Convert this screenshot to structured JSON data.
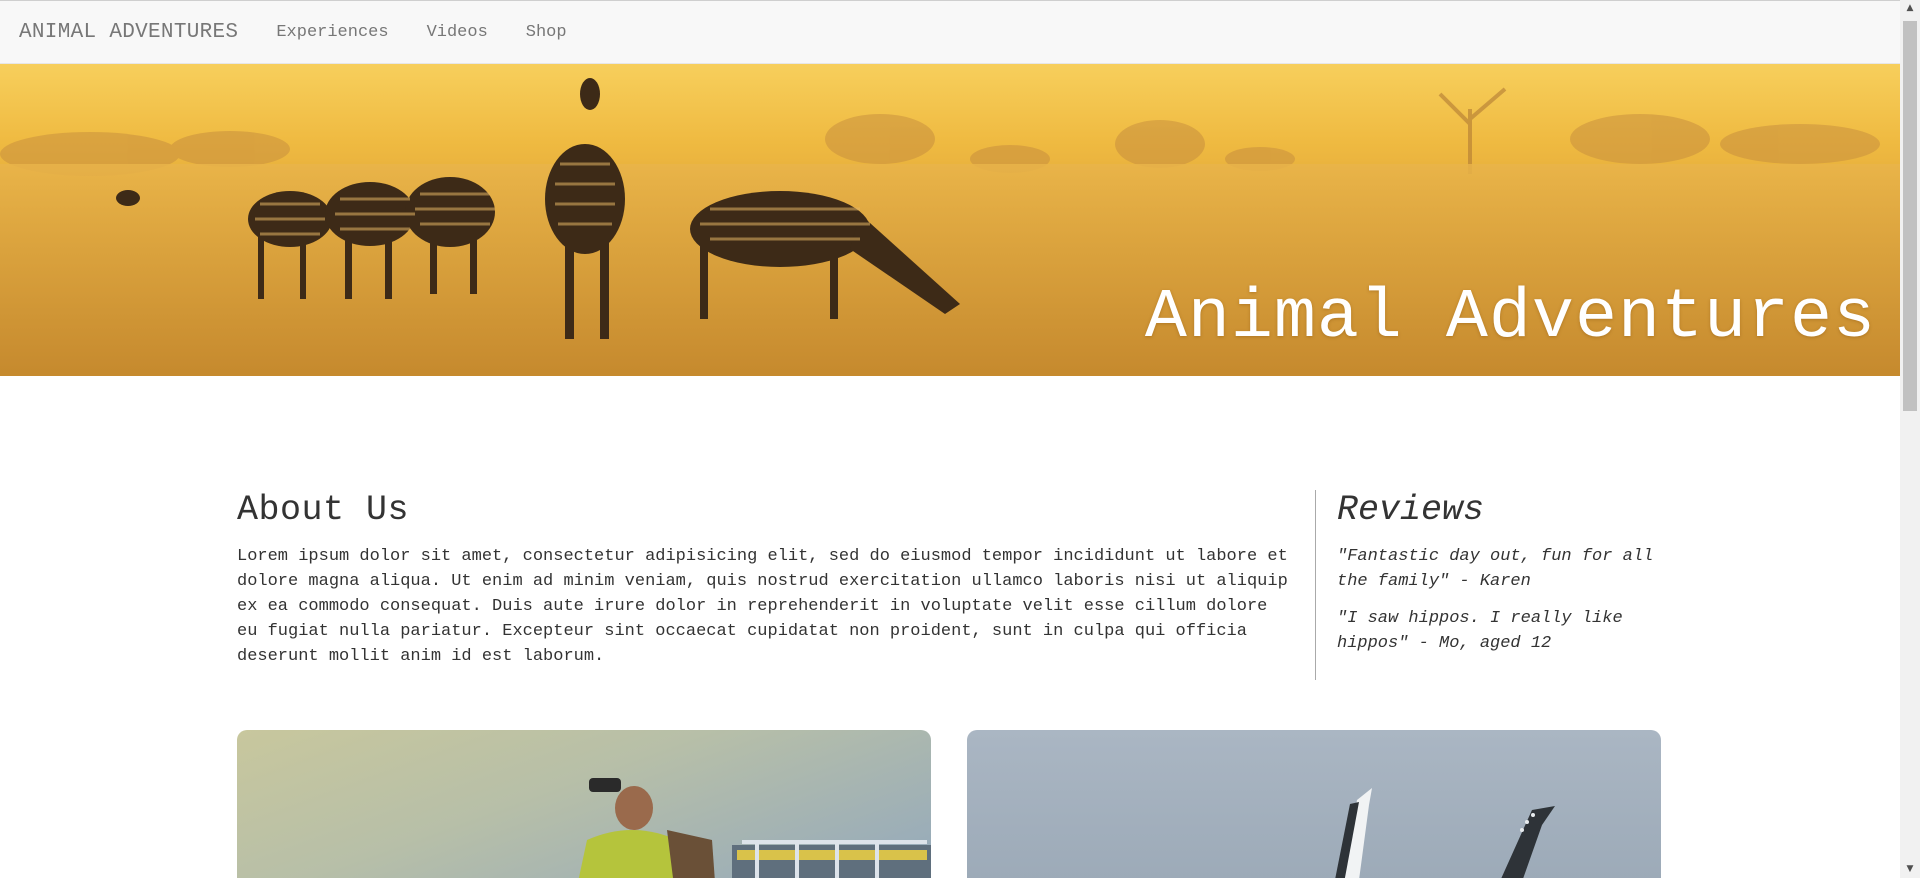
{
  "navbar": {
    "brand": "ANIMAL ADVENTURES",
    "links": [
      "Experiences",
      "Videos",
      "Shop"
    ]
  },
  "hero": {
    "title": "Animal Adventures"
  },
  "about": {
    "heading": "About Us",
    "body": "Lorem ipsum dolor sit amet, consectetur adipisicing elit, sed do eiusmod tempor incididunt ut labore et dolore magna aliqua. Ut enim ad minim veniam, quis nostrud exercitation ullamco laboris nisi ut aliquip ex ea commodo consequat. Duis aute irure dolor in reprehenderit in voluptate velit esse cillum dolore eu fugiat nulla pariatur. Excepteur sint occaecat cupidatat non proident, sunt in culpa qui officia deserunt mollit anim id est laborum."
  },
  "reviews": {
    "heading": "Reviews",
    "items": [
      "\"Fantastic day out, fun for all the family\" - Karen",
      "\"I saw hippos. I really like hippos\" - Mo, aged 12"
    ]
  },
  "icons": {
    "scroll_up": "scroll-up-arrow-icon",
    "scroll_down": "scroll-down-arrow-icon"
  },
  "colors": {
    "navbar_bg": "#f8f8f8",
    "nav_text": "#777777",
    "hero_gold": "#efba41",
    "text": "#333333"
  }
}
